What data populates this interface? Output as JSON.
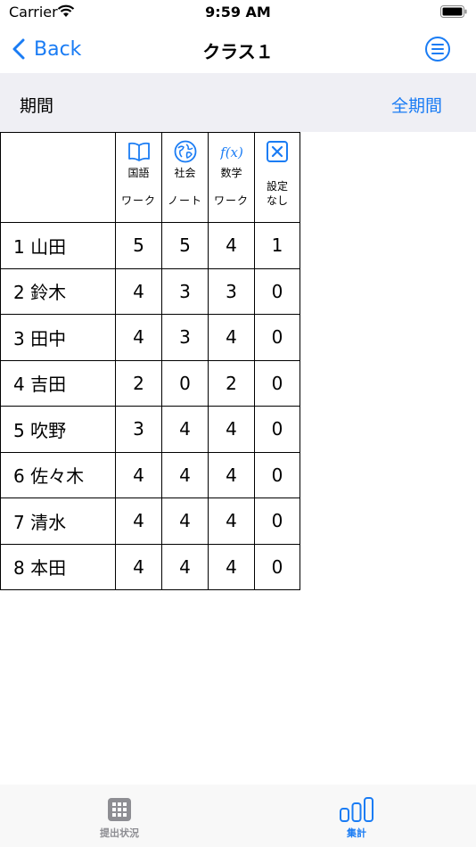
{
  "status": {
    "carrier": "Carrier",
    "time": "9:59 AM"
  },
  "nav": {
    "back_label": "Back",
    "title": "クラス１"
  },
  "period": {
    "label": "期間",
    "value": "全期間"
  },
  "table": {
    "columns": [
      {
        "subject": "国語",
        "kind": "ワーク",
        "icon": "book-icon"
      },
      {
        "subject": "社会",
        "kind": "ノート",
        "icon": "globe-map-icon"
      },
      {
        "subject": "数学",
        "kind": "ワーク",
        "icon": "function-icon"
      },
      {
        "subject": "",
        "kind": "設定なし",
        "icon": "x-square-icon"
      }
    ],
    "rows": [
      {
        "name": "1 山田",
        "values": [
          "5",
          "5",
          "4",
          "1"
        ]
      },
      {
        "name": "2 鈴木",
        "values": [
          "4",
          "3",
          "3",
          "0"
        ]
      },
      {
        "name": "3 田中",
        "values": [
          "4",
          "3",
          "4",
          "0"
        ]
      },
      {
        "name": "4 吉田",
        "values": [
          "2",
          "0",
          "2",
          "0"
        ]
      },
      {
        "name": "5 吹野",
        "values": [
          "3",
          "4",
          "4",
          "0"
        ]
      },
      {
        "name": "6 佐々木",
        "values": [
          "4",
          "4",
          "4",
          "0"
        ]
      },
      {
        "name": "7 清水",
        "values": [
          "4",
          "4",
          "4",
          "0"
        ]
      },
      {
        "name": "8 本田",
        "values": [
          "4",
          "4",
          "4",
          "0"
        ]
      }
    ]
  },
  "tabs": [
    {
      "label": "提出状況",
      "icon": "grid-icon",
      "active": false
    },
    {
      "label": "集計",
      "icon": "bar-chart-icon",
      "active": true
    }
  ],
  "colors": {
    "accent": "#1a7cf4",
    "inactive": "#8e8e93",
    "period_bg": "#efeff4"
  }
}
